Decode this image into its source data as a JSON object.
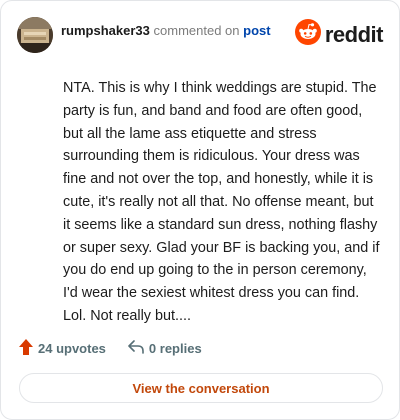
{
  "comment": {
    "username": "rumpshaker33",
    "commented_on_text": "commented on",
    "post_link_text": "post",
    "body": "NTA. This is why I think weddings are stupid. The party is fun, and band and food are often good, but all the lame ass etiquette and stress surrounding them is ridiculous. Your dress was fine and not over the top, and honestly, while it is cute, it's really not all that. No offense meant, but it seems like a standard sun dress, nothing flashy or super sexy. Glad your BF is backing you, and if you do end up going to the in person ceremony, I'd wear the sexiest whitest dress you can find. Lol. Not really but...."
  },
  "brand": {
    "name": "reddit",
    "icon": "reddit-logo-icon",
    "color": "#ff4500"
  },
  "footer": {
    "upvotes_label": "24 upvotes",
    "upvote_icon": "upvote-arrow-icon",
    "upvote_color": "#d93a00",
    "replies_label": "0 replies",
    "reply_icon": "reply-arrow-icon"
  },
  "cta": {
    "label": "View the conversation",
    "color": "#c2480b"
  }
}
